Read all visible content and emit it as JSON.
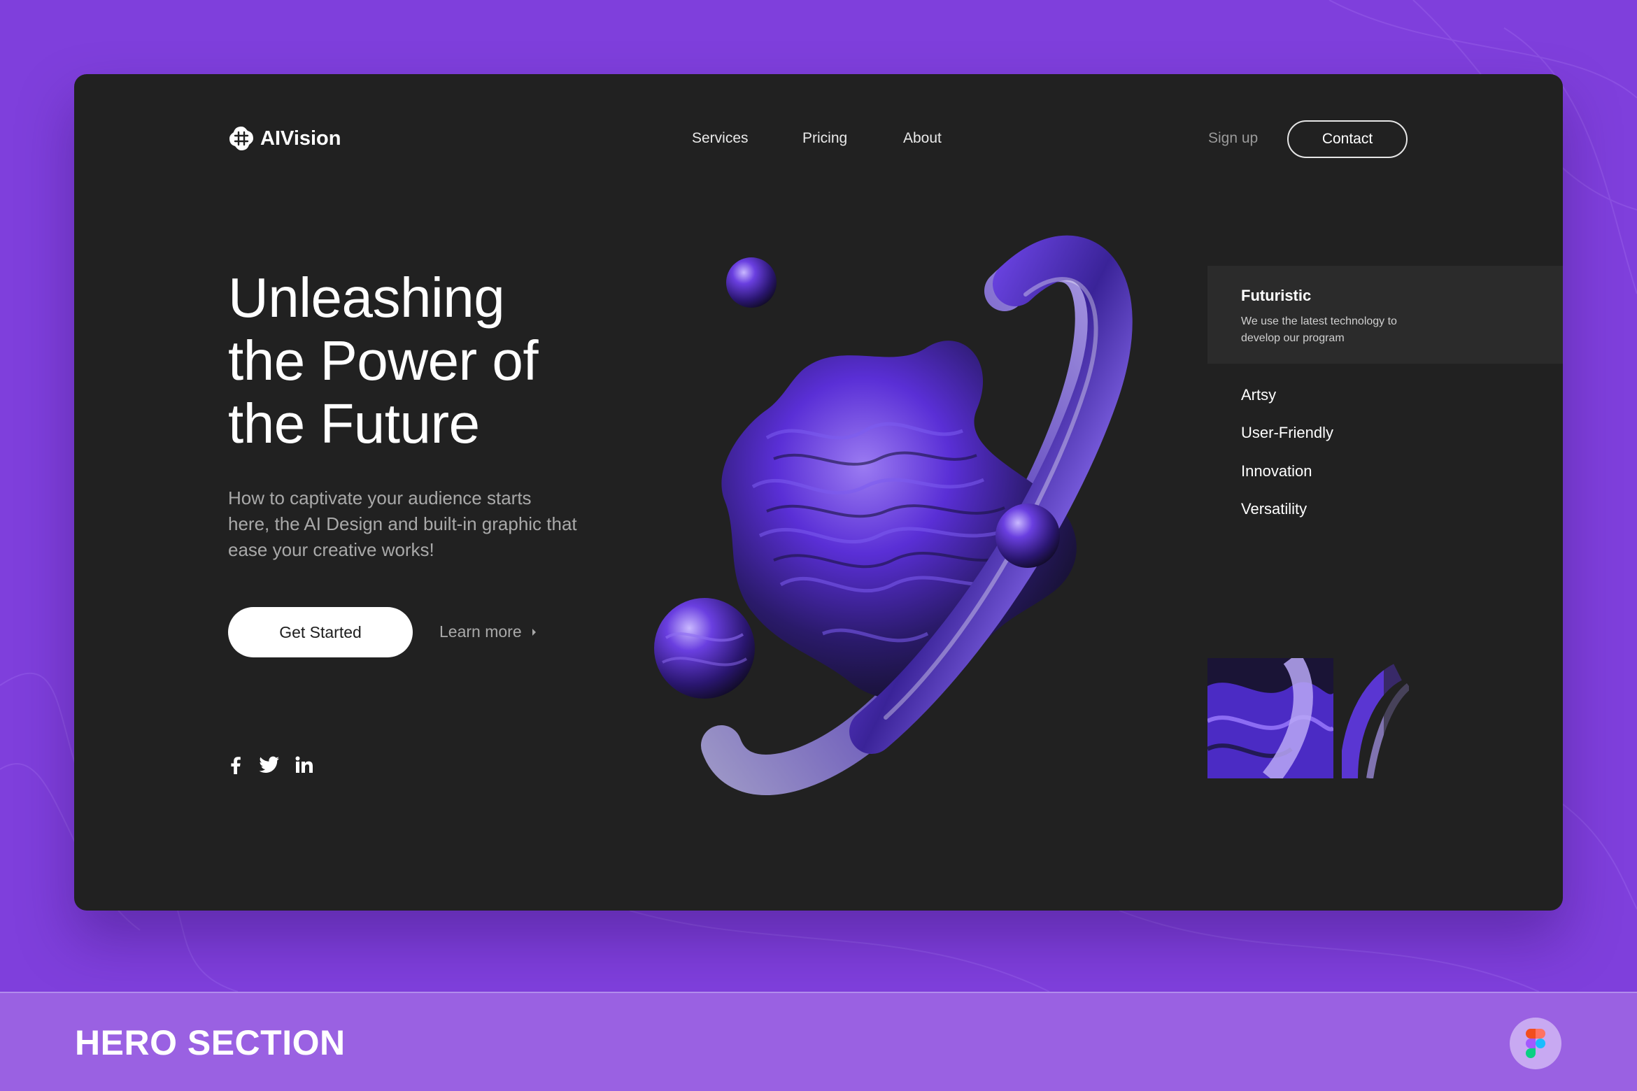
{
  "brand": {
    "name": "AIVision",
    "icon": "brand-logo-icon"
  },
  "nav": {
    "links": [
      {
        "label": "Services"
      },
      {
        "label": "Pricing"
      },
      {
        "label": "About"
      }
    ],
    "signup_label": "Sign up",
    "contact_label": "Contact"
  },
  "hero": {
    "headline": "Unleashing the Power of the Future",
    "subtitle": "How to captivate your audience starts here, the AI Design and built-in graphic that ease your creative works!",
    "primary_cta": "Get Started",
    "secondary_cta": "Learn more",
    "socials": [
      {
        "icon": "facebook-icon"
      },
      {
        "icon": "twitter-icon"
      },
      {
        "icon": "linkedin-icon"
      }
    ]
  },
  "features": {
    "active": {
      "title": "Futuristic",
      "description": "We use the latest technology to develop our program"
    },
    "items": [
      {
        "label": "Artsy"
      },
      {
        "label": "User-Friendly"
      },
      {
        "label": "Innovation"
      },
      {
        "label": "Versatility"
      }
    ]
  },
  "footer": {
    "title": "HERO SECTION",
    "icon": "figma-icon"
  },
  "colors": {
    "background": "#7f3fdc",
    "card": "#212121",
    "footer_strip": "#9a61e2",
    "accent_purple": "#5a2fd6"
  }
}
